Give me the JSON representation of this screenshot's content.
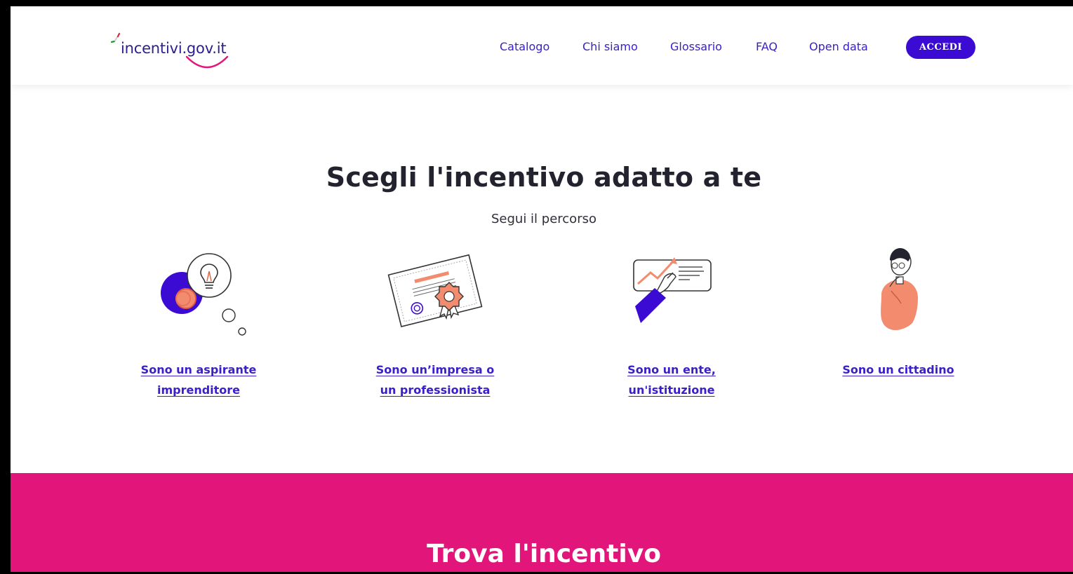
{
  "header": {
    "logo_text": "incentivi.gov.it",
    "nav": [
      {
        "label": "Catalogo"
      },
      {
        "label": "Chi siamo"
      },
      {
        "label": "Glossario"
      },
      {
        "label": "FAQ"
      },
      {
        "label": "Open data"
      }
    ],
    "login_label": "ACCEDI"
  },
  "hero": {
    "title": "Scegli l'incentivo adatto a te",
    "subtitle": "Segui il percorso"
  },
  "paths": [
    {
      "line1": "Sono un aspirante",
      "line2": "imprenditore",
      "icon": "lightbulb-icon"
    },
    {
      "line1": "Sono un’impresa o",
      "line2": "un professionista",
      "icon": "certificate-icon"
    },
    {
      "line1": "Sono un ente,",
      "line2": "un'istituzione",
      "icon": "presentation-chart-icon"
    },
    {
      "line1": "Sono un cittadino",
      "line2": "",
      "icon": "citizen-person-icon"
    }
  ],
  "search_section": {
    "title": "Trova l'incentivo"
  },
  "colors": {
    "brand_blue": "#3b0bd4",
    "link": "#3a20c8",
    "accent_pink": "#e2167a",
    "accent_orange": "#f38b6f"
  }
}
